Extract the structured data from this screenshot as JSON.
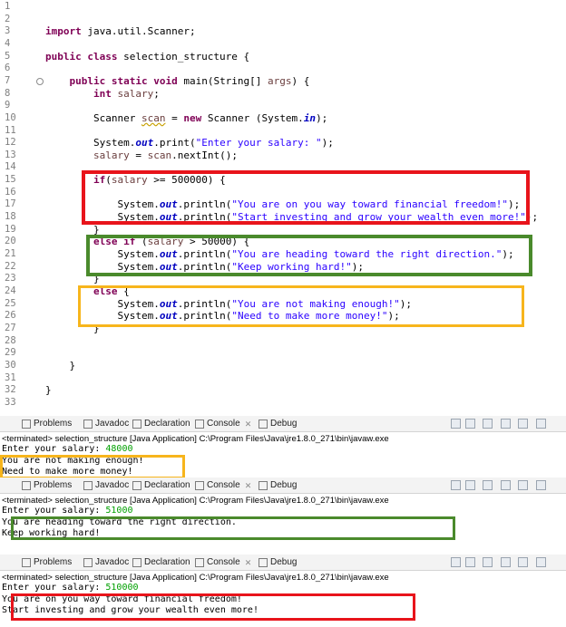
{
  "editor": {
    "lines": [
      {
        "n": "1",
        "segs": []
      },
      {
        "n": "2",
        "segs": []
      },
      {
        "n": "3",
        "segs": [
          {
            "t": "import ",
            "c": "kw"
          },
          {
            "t": "java.util.Scanner;",
            "c": ""
          }
        ]
      },
      {
        "n": "4",
        "segs": []
      },
      {
        "n": "5",
        "segs": [
          {
            "t": "public class ",
            "c": "kw"
          },
          {
            "t": "selection_structure {",
            "c": ""
          }
        ]
      },
      {
        "n": "6",
        "segs": []
      },
      {
        "n": "7",
        "segs": [
          {
            "t": "    public static void ",
            "c": "kw"
          },
          {
            "t": "main(String[] ",
            "c": ""
          },
          {
            "t": "args",
            "c": "var"
          },
          {
            "t": ") {",
            "c": ""
          }
        ]
      },
      {
        "n": "8",
        "segs": [
          {
            "t": "        int ",
            "c": "kw"
          },
          {
            "t": "salary",
            "c": "var"
          },
          {
            "t": ";",
            "c": ""
          }
        ]
      },
      {
        "n": "9",
        "segs": []
      },
      {
        "n": "10",
        "segs": [
          {
            "t": "        Scanner ",
            "c": ""
          },
          {
            "t": "scan",
            "c": "var ul"
          },
          {
            "t": " = ",
            "c": ""
          },
          {
            "t": "new ",
            "c": "kw"
          },
          {
            "t": "Scanner (System.",
            "c": ""
          },
          {
            "t": "in",
            "c": "fld"
          },
          {
            "t": ");",
            "c": ""
          }
        ]
      },
      {
        "n": "11",
        "segs": []
      },
      {
        "n": "12",
        "segs": [
          {
            "t": "        System.",
            "c": ""
          },
          {
            "t": "out",
            "c": "fld"
          },
          {
            "t": ".print(",
            "c": ""
          },
          {
            "t": "\"Enter your salary: \"",
            "c": "str"
          },
          {
            "t": ");",
            "c": ""
          }
        ]
      },
      {
        "n": "13",
        "segs": [
          {
            "t": "        ",
            "c": ""
          },
          {
            "t": "salary",
            "c": "var"
          },
          {
            "t": " = ",
            "c": ""
          },
          {
            "t": "scan",
            "c": "var"
          },
          {
            "t": ".nextInt();",
            "c": ""
          }
        ]
      },
      {
        "n": "14",
        "segs": []
      },
      {
        "n": "15",
        "segs": [
          {
            "t": "        ",
            "c": ""
          },
          {
            "t": "if",
            "c": "kw"
          },
          {
            "t": "(",
            "c": ""
          },
          {
            "t": "salary",
            "c": "var"
          },
          {
            "t": " >= 500000) {",
            "c": ""
          }
        ]
      },
      {
        "n": "16",
        "segs": []
      },
      {
        "n": "17",
        "segs": [
          {
            "t": "            System.",
            "c": ""
          },
          {
            "t": "out",
            "c": "fld"
          },
          {
            "t": ".println(",
            "c": ""
          },
          {
            "t": "\"You are on you way toward financial freedom!\"",
            "c": "str"
          },
          {
            "t": ");",
            "c": ""
          }
        ]
      },
      {
        "n": "18",
        "segs": [
          {
            "t": "            System.",
            "c": ""
          },
          {
            "t": "out",
            "c": "fld"
          },
          {
            "t": ".println(",
            "c": ""
          },
          {
            "t": "\"Start investing and grow your wealth even more!\"",
            "c": "str"
          },
          {
            "t": ");",
            "c": ""
          }
        ]
      },
      {
        "n": "19",
        "segs": [
          {
            "t": "        }",
            "c": ""
          }
        ]
      },
      {
        "n": "20",
        "segs": [
          {
            "t": "        ",
            "c": ""
          },
          {
            "t": "else if ",
            "c": "kw"
          },
          {
            "t": "(",
            "c": ""
          },
          {
            "t": "salary",
            "c": "var"
          },
          {
            "t": " > 50000) {",
            "c": ""
          }
        ]
      },
      {
        "n": "21",
        "segs": [
          {
            "t": "            System.",
            "c": ""
          },
          {
            "t": "out",
            "c": "fld"
          },
          {
            "t": ".println(",
            "c": ""
          },
          {
            "t": "\"You are heading toward the right direction.\"",
            "c": "str"
          },
          {
            "t": ");",
            "c": ""
          }
        ]
      },
      {
        "n": "22",
        "segs": [
          {
            "t": "            System.",
            "c": ""
          },
          {
            "t": "out",
            "c": "fld"
          },
          {
            "t": ".println(",
            "c": ""
          },
          {
            "t": "\"Keep working hard!\"",
            "c": "str"
          },
          {
            "t": ");",
            "c": ""
          }
        ]
      },
      {
        "n": "23",
        "segs": [
          {
            "t": "        }",
            "c": ""
          }
        ]
      },
      {
        "n": "24",
        "segs": [
          {
            "t": "        ",
            "c": ""
          },
          {
            "t": "else ",
            "c": "kw"
          },
          {
            "t": "{",
            "c": ""
          }
        ]
      },
      {
        "n": "25",
        "segs": [
          {
            "t": "            System.",
            "c": ""
          },
          {
            "t": "out",
            "c": "fld"
          },
          {
            "t": ".println(",
            "c": ""
          },
          {
            "t": "\"You are not making enough!\"",
            "c": "str"
          },
          {
            "t": ");",
            "c": ""
          }
        ]
      },
      {
        "n": "26",
        "segs": [
          {
            "t": "            System.",
            "c": ""
          },
          {
            "t": "out",
            "c": "fld"
          },
          {
            "t": ".println(",
            "c": ""
          },
          {
            "t": "\"Need to make more money!\"",
            "c": "str"
          },
          {
            "t": ");",
            "c": ""
          }
        ]
      },
      {
        "n": "27",
        "segs": [
          {
            "t": "        }",
            "c": ""
          }
        ]
      },
      {
        "n": "28",
        "segs": []
      },
      {
        "n": "29",
        "segs": []
      },
      {
        "n": "30",
        "segs": [
          {
            "t": "    }",
            "c": ""
          }
        ]
      },
      {
        "n": "31",
        "segs": []
      },
      {
        "n": "32",
        "segs": [
          {
            "t": "}",
            "c": ""
          }
        ]
      },
      {
        "n": "33",
        "segs": []
      }
    ],
    "highlights": [
      {
        "name": "highlight-if-block",
        "color": "#e8141b"
      },
      {
        "name": "highlight-else-if-block",
        "color": "#4a8a2c"
      },
      {
        "name": "highlight-else-block",
        "color": "#f7b51c"
      }
    ]
  },
  "console_tabs": [
    {
      "label": "Problems",
      "icon": "problems-icon"
    },
    {
      "label": "Javadoc",
      "icon": "javadoc-icon"
    },
    {
      "label": "Declaration",
      "icon": "declaration-icon"
    },
    {
      "label": "Console",
      "icon": "console-icon",
      "closable": true
    },
    {
      "label": "Debug",
      "icon": "debug-icon"
    }
  ],
  "consoles": [
    {
      "status": "<terminated> selection_structure [Java Application] C:\\Program Files\\Java\\jre1.8.0_271\\bin\\javaw.exe",
      "prompt": "Enter your salary: ",
      "input": "48000",
      "output": [
        "You are not making enough!",
        "Need to make more money!"
      ],
      "highlight_color": "#f7b51c"
    },
    {
      "status": "<terminated> selection_structure [Java Application] C:\\Program Files\\Java\\jre1.8.0_271\\bin\\javaw.exe",
      "prompt": "Enter your salary: ",
      "input": "51000",
      "output": [
        "You are heading toward the right direction.",
        "Keep working hard!"
      ],
      "highlight_color": "#4a8a2c"
    },
    {
      "status": "<terminated> selection_structure [Java Application] C:\\Program Files\\Java\\jre1.8.0_271\\bin\\javaw.exe",
      "prompt": "Enter your salary: ",
      "input": "510000",
      "output": [
        "You are on you way toward financial freedom!",
        "Start investing and grow your wealth even more!"
      ],
      "highlight_color": "#e8141b"
    }
  ]
}
